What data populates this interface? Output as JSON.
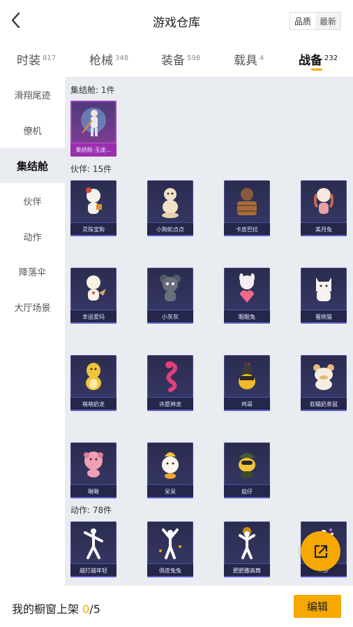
{
  "header": {
    "title": "游戏仓库",
    "sort_quality": "品质",
    "sort_latest": "最新"
  },
  "tabs": [
    {
      "label": "时装",
      "count": "817"
    },
    {
      "label": "枪械",
      "count": "348"
    },
    {
      "label": "装备",
      "count": "598"
    },
    {
      "label": "载具",
      "count": "4"
    },
    {
      "label": "战备",
      "count": "232",
      "active": true
    }
  ],
  "sidebar": {
    "items": [
      {
        "label": "滑翔尾迹"
      },
      {
        "label": "僚机"
      },
      {
        "label": "集结舱",
        "active": true
      },
      {
        "label": "伙伴"
      },
      {
        "label": "动作"
      },
      {
        "label": "降落伞"
      },
      {
        "label": "大厅场景"
      }
    ]
  },
  "sections": {
    "pod": {
      "label": "集结舱: 1件",
      "items": [
        "集结舱-玉虚..."
      ]
    },
    "companion": {
      "label": "伙伴: 15件",
      "items": [
        "灵珠宝狗",
        "小狗蛇点点",
        "卡皮巴拉",
        "美月兔",
        "幸运爱玛",
        "小灰灰",
        "眠眠兔",
        "蜜桃猫",
        "萌萌奶龙",
        "许愿神龙",
        "鸡哥",
        "软糯奶茶鼠",
        "啾啾",
        "呆呆",
        "菇仔"
      ]
    },
    "emote": {
      "label": "动作: 78件",
      "items": [
        "越打越年轻",
        "俏皮兔兔",
        "肥肥撒高舞",
        "...步"
      ]
    }
  },
  "bottom": {
    "showcase_label": "我的橱窗上架",
    "showcase_count": "0",
    "showcase_total": "/5",
    "edit_label": "编辑"
  },
  "icons": {
    "back": "chevron-left-icon",
    "share": "share-external-icon"
  },
  "colors": {
    "accent": "#f5a800",
    "card_bg": "#2a2c4e",
    "content_bg": "#e9ecf0",
    "special_card": "#9b2fb0"
  }
}
